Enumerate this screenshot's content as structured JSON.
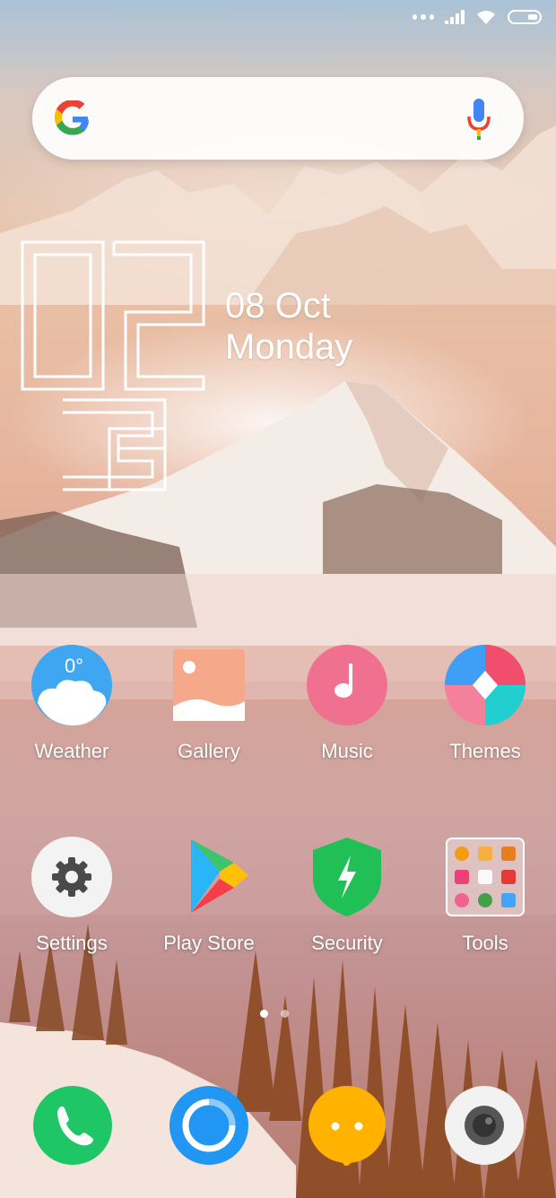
{
  "status_bar": {
    "icons": [
      "signal-dots-icon",
      "cellular-signal-icon",
      "wifi-icon",
      "battery-icon"
    ]
  },
  "search": {
    "icons": [
      "google-g-icon",
      "microphone-icon"
    ]
  },
  "clock": {
    "hours": "02",
    "minutes": "36"
  },
  "date": {
    "day_month": "08 Oct",
    "weekday": "Monday"
  },
  "apps_row1": [
    {
      "label": "Weather",
      "icon": "weather-icon",
      "badge": "0°"
    },
    {
      "label": "Gallery",
      "icon": "gallery-icon"
    },
    {
      "label": "Music",
      "icon": "music-icon"
    },
    {
      "label": "Themes",
      "icon": "themes-icon"
    }
  ],
  "apps_row2": [
    {
      "label": "Settings",
      "icon": "settings-icon"
    },
    {
      "label": "Play Store",
      "icon": "play-store-icon"
    },
    {
      "label": "Security",
      "icon": "security-icon"
    },
    {
      "label": "Tools",
      "icon": "tools-folder-icon"
    }
  ],
  "pager": {
    "pages": 2,
    "active": 1
  },
  "dock": [
    {
      "icon": "phone-icon",
      "color": "#1fc665"
    },
    {
      "icon": "browser-icon",
      "color": "#2196f3"
    },
    {
      "icon": "messaging-icon",
      "color": "#ffb300"
    },
    {
      "icon": "camera-icon",
      "color": "#f2f2f2"
    }
  ]
}
